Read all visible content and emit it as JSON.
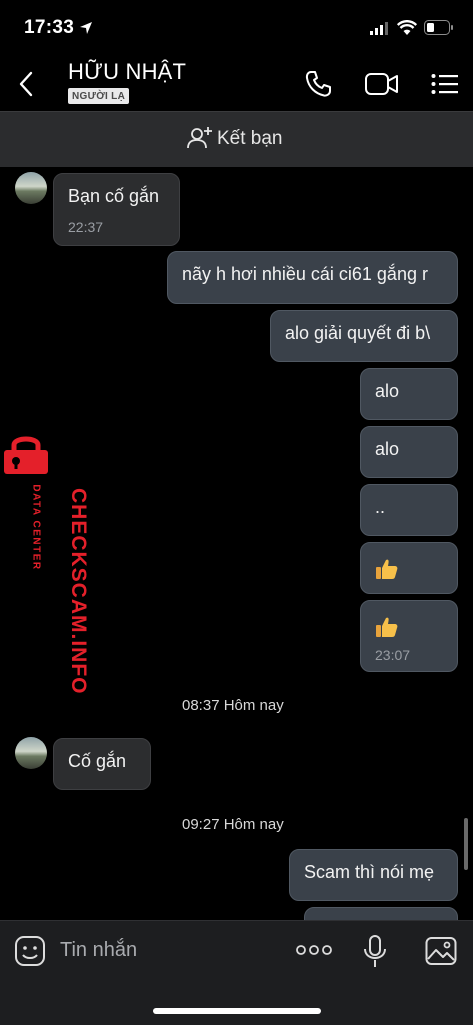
{
  "status_bar": {
    "time": "17:33"
  },
  "header": {
    "contact_name": "HỮU NHẬT",
    "badge": "NGƯỜI LẠ"
  },
  "friend_bar": {
    "label": "Kết bạn"
  },
  "messages": [
    {
      "side": "received",
      "text": "Bạn cố gắn",
      "time": "22:37"
    },
    {
      "side": "sent",
      "text": "nãy h hơi nhiều cái ci61 gắng r"
    },
    {
      "side": "sent",
      "text": "alo giải quyết đi b\\"
    },
    {
      "side": "sent",
      "text": "alo"
    },
    {
      "side": "sent",
      "text": "alo"
    },
    {
      "side": "sent",
      "text": ".."
    },
    {
      "side": "sent",
      "sticker": "thumbs-up"
    },
    {
      "side": "sent",
      "sticker": "thumbs-up",
      "time": "23:07"
    },
    {
      "side": "received",
      "text": "Cố gắn"
    },
    {
      "side": "sent",
      "text": "Scam thì nói mẹ"
    }
  ],
  "separators": [
    "08:37 Hôm nay",
    "09:27 Hôm nay"
  ],
  "watermark": {
    "main": "CHECKSCAM.INFO",
    "sub": "DATA CENTER"
  },
  "input_bar": {
    "placeholder": "Tin nhắn"
  },
  "colors": {
    "accent_red": "#e4202a",
    "sent_bubble": "#3a414a",
    "received_bubble": "#2c2d2f"
  }
}
